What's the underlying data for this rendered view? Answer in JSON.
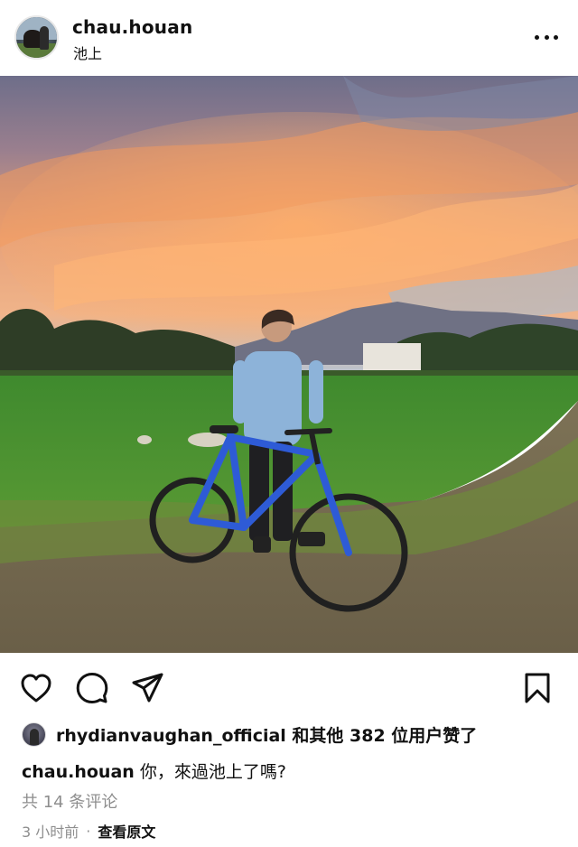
{
  "post": {
    "username": "chau.houan",
    "location": "池上",
    "more_icon": "more-horizontal-icon"
  },
  "photo": {
    "alt_description": ""
  },
  "actions": {
    "like_icon": "heart-icon",
    "comment_icon": "comment-icon",
    "share_icon": "send-icon",
    "save_icon": "bookmark-icon"
  },
  "likes": {
    "text": "rhydianvaughan_official 和其他 382 位用户赞了"
  },
  "caption": {
    "username": "chau.houan",
    "text": "你，來過池上了嗎?"
  },
  "comments": {
    "text": "共 14 条评论"
  },
  "meta": {
    "time": "3 小时前",
    "separator": "·",
    "view_original": "查看原文"
  }
}
